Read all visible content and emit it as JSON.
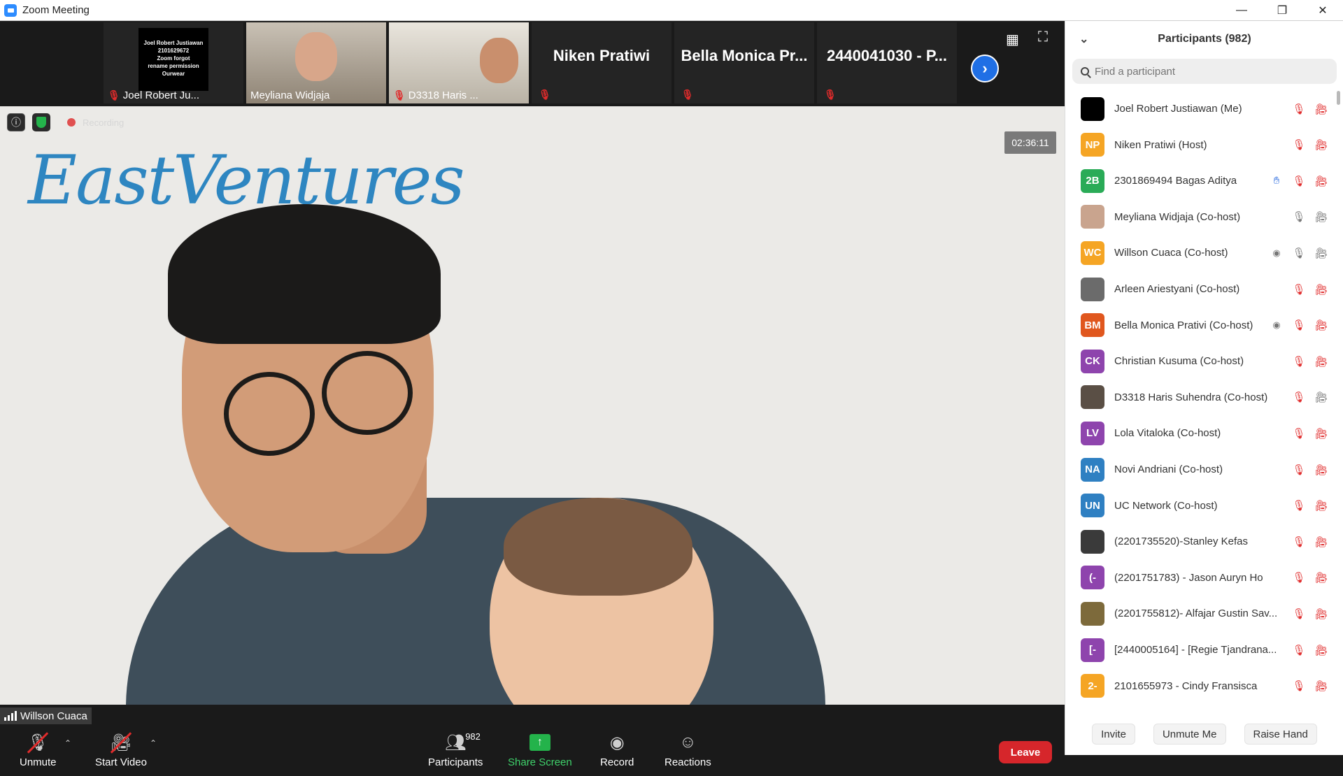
{
  "window": {
    "title": "Zoom Meeting"
  },
  "strip": {
    "thumbs": [
      {
        "name": "Joel Robert Ju...",
        "poster": [
          "Joel Robert Justiawan",
          "2101629672",
          "Zoom forgot",
          "rename permission",
          "Ourwear"
        ]
      },
      {
        "name": "Meyliana Widjaja"
      },
      {
        "name": "D3318 Haris ..."
      },
      {
        "name": "Niken Pratiwi"
      },
      {
        "name": "Bella Monica Pr..."
      },
      {
        "name": "2440041030 - P..."
      }
    ]
  },
  "video": {
    "logo": "EastVentures",
    "recording_label": "Recording",
    "timer": "02:36:11",
    "speaker": "Willson Cuaca"
  },
  "toolbar": {
    "unmute": "Unmute",
    "start_video": "Start Video",
    "participants": "Participants",
    "participants_count": "982",
    "share_screen": "Share Screen",
    "record": "Record",
    "reactions": "Reactions",
    "leave": "Leave"
  },
  "panel": {
    "title": "Participants (982)",
    "search_placeholder": "Find a participant",
    "participants": [
      {
        "name": "Joel Robert Justiawan (Me)",
        "initials": "",
        "color": "#000000",
        "icons": [
          "mic-muted",
          "video-off"
        ]
      },
      {
        "name": "Niken Pratiwi (Host)",
        "initials": "NP",
        "color": "#f5a524",
        "icons": [
          "mic-muted",
          "video-off"
        ]
      },
      {
        "name": "2301869494 Bagas Aditya",
        "initials": "2B",
        "color": "#2aab57",
        "icons": [
          "hand",
          "mic-muted",
          "video-off"
        ]
      },
      {
        "name": "Meyliana Widjaja (Co-host)",
        "initials": "",
        "color": "#c9a48e",
        "icons": [
          "mic-on",
          "video-on"
        ]
      },
      {
        "name": "Willson Cuaca (Co-host)",
        "initials": "WC",
        "color": "#f5a524",
        "icons": [
          "recording",
          "mic-on",
          "video-on"
        ]
      },
      {
        "name": "Arleen Ariestyani (Co-host)",
        "initials": "",
        "color": "#6b6b6b",
        "icons": [
          "mic-muted",
          "video-off"
        ]
      },
      {
        "name": "Bella Monica Prativi (Co-host)",
        "initials": "BM",
        "color": "#e0571e",
        "icons": [
          "recording",
          "mic-muted",
          "video-off"
        ]
      },
      {
        "name": "Christian Kusuma (Co-host)",
        "initials": "CK",
        "color": "#8e44ad",
        "icons": [
          "mic-muted",
          "video-off"
        ]
      },
      {
        "name": "D3318 Haris Suhendra (Co-host)",
        "initials": "",
        "color": "#5a4f45",
        "icons": [
          "mic-muted",
          "video-on"
        ]
      },
      {
        "name": "Lola Vitaloka (Co-host)",
        "initials": "LV",
        "color": "#8e44ad",
        "icons": [
          "mic-muted",
          "video-off"
        ]
      },
      {
        "name": "Novi Andriani (Co-host)",
        "initials": "NA",
        "color": "#2f80c2",
        "icons": [
          "mic-muted",
          "video-off"
        ]
      },
      {
        "name": "UC Network (Co-host)",
        "initials": "UN",
        "color": "#2f80c2",
        "icons": [
          "mic-muted",
          "video-off"
        ]
      },
      {
        "name": "(2201735520)-Stanley Kefas",
        "initials": "",
        "color": "#3a3a3a",
        "icons": [
          "mic-muted",
          "video-off"
        ]
      },
      {
        "name": "(2201751783) - Jason Auryn Ho",
        "initials": "(-",
        "color": "#8e44ad",
        "icons": [
          "mic-muted",
          "video-off"
        ]
      },
      {
        "name": "(2201755812)- Alfajar Gustin Sav...",
        "initials": "",
        "color": "#7d6a3b",
        "icons": [
          "mic-muted",
          "video-off"
        ]
      },
      {
        "name": "[2440005164] - [Regie Tjandrana...",
        "initials": "[-",
        "color": "#8e44ad",
        "icons": [
          "mic-muted",
          "video-off"
        ]
      },
      {
        "name": "2101655973 - Cindy Fransisca",
        "initials": "2-",
        "color": "#f5a524",
        "icons": [
          "mic-muted",
          "video-off"
        ]
      }
    ],
    "footer": {
      "invite": "Invite",
      "unmute_me": "Unmute Me",
      "raise_hand": "Raise Hand"
    }
  }
}
